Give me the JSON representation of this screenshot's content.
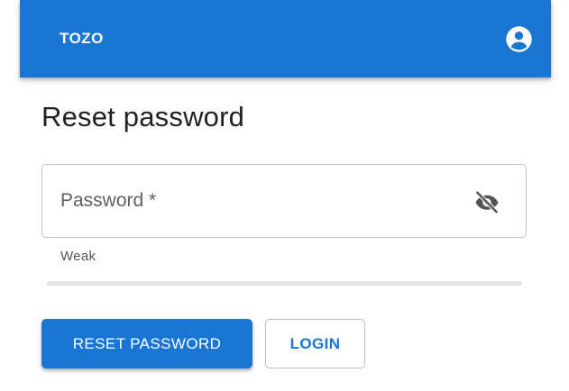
{
  "appbar": {
    "brand": "TOZO",
    "account_icon": "account-circle-icon",
    "color": "#1976d2"
  },
  "form": {
    "title": "Reset password",
    "password_field": {
      "label": "Password *",
      "value": "",
      "visibility_icon": "visibility-off-icon"
    },
    "strength": {
      "label": "Weak",
      "level": 0
    },
    "reset_button_label": "RESET PASSWORD",
    "login_button_label": "LOGIN"
  },
  "colors": {
    "primary": "#1976d2",
    "text": "#222222",
    "muted": "#5f5f5f",
    "border": "#c4c4c4"
  }
}
